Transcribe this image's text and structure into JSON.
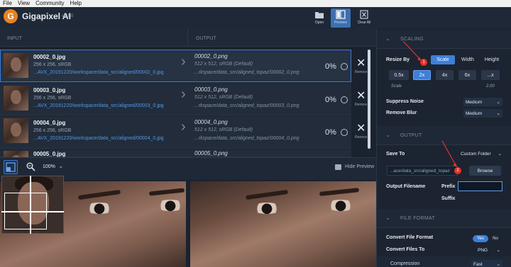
{
  "menu": [
    "File",
    "View",
    "Community",
    "Help"
  ],
  "app": {
    "logo_letter": "G",
    "name": "Gigapixel AI",
    "version": "v4.1.0"
  },
  "toolbar": {
    "open": "Open",
    "preview": "Preview",
    "clear_all": "Clear All"
  },
  "columns": {
    "input": "INPUT",
    "output": "OUTPUT"
  },
  "files": [
    {
      "name": "00002_0.jpg",
      "meta": "256 x 256, sRGB",
      "path": "...AVX_20191220/workspace/data_src/aligned/00002_0.jpg",
      "out_name": "00002_0.png",
      "out_meta": "512 x 512, sRGB (Default)",
      "out_path": "...rkspace/data_src/aligned_topaz/00002_0.png",
      "progress": "0%",
      "remove": "Remove"
    },
    {
      "name": "00003_0.jpg",
      "meta": "256 x 256, sRGB",
      "path": "...AVX_20191220/workspace/data_src/aligned/00003_0.jpg",
      "out_name": "00003_0.png",
      "out_meta": "512 x 512, sRGB (Default)",
      "out_path": "...rkspace/data_src/aligned_topaz/00003_0.png",
      "progress": "0%",
      "remove": "Remove"
    },
    {
      "name": "00004_0.jpg",
      "meta": "256 x 256, sRGB",
      "path": "...AVX_20191220/workspace/data_src/aligned/00004_0.jpg",
      "out_name": "00004_0.png",
      "out_meta": "512 x 512, sRGB (Default)",
      "out_path": "...rkspace/data_src/aligned_topaz/00004_0.png",
      "progress": "0%",
      "remove": "Remove"
    },
    {
      "name": "00005_0.jpg",
      "out_name": "00005_0.png"
    }
  ],
  "preview_bar": {
    "zoom": "100%",
    "hide_preview": "Hide Preview"
  },
  "scaling": {
    "title": "SCALING",
    "resize_by": "Resize By",
    "modes": [
      "Scale",
      "Width",
      "Height"
    ],
    "active_mode": "Scale",
    "factors": [
      "0.5x",
      "2x",
      "4x",
      "6x",
      "...x"
    ],
    "active_factor": "2x",
    "scale_label": "Scale",
    "scale_value": "2.00",
    "suppress_noise_label": "Suppress Noise",
    "suppress_noise": "Medium",
    "remove_blur_label": "Remove Blur",
    "remove_blur": "Medium"
  },
  "output": {
    "title": "OUTPUT",
    "save_to": "Save To",
    "folder_option": "Custom Folder",
    "folder_path": "...ace/data_src/aligned_topaz",
    "browse": "Browse",
    "filename_label": "Output Filename",
    "prefix_label": "Prefix",
    "prefix_value": "",
    "suffix_label": "Suffix",
    "suffix_value": ""
  },
  "file_format": {
    "title": "FILE FORMAT",
    "convert_label": "Convert File Format",
    "yes": "Yes",
    "no": "No",
    "convert_to_label": "Convert Files To",
    "convert_to": "PNG",
    "compression_label": "Compression",
    "compression": "Fast"
  },
  "annotations": [
    "1",
    "2"
  ],
  "colors": {
    "accent": "#3d7fd9",
    "logo": "#e8831e",
    "annotation": "#e8302a",
    "link": "#4f9ae8"
  }
}
